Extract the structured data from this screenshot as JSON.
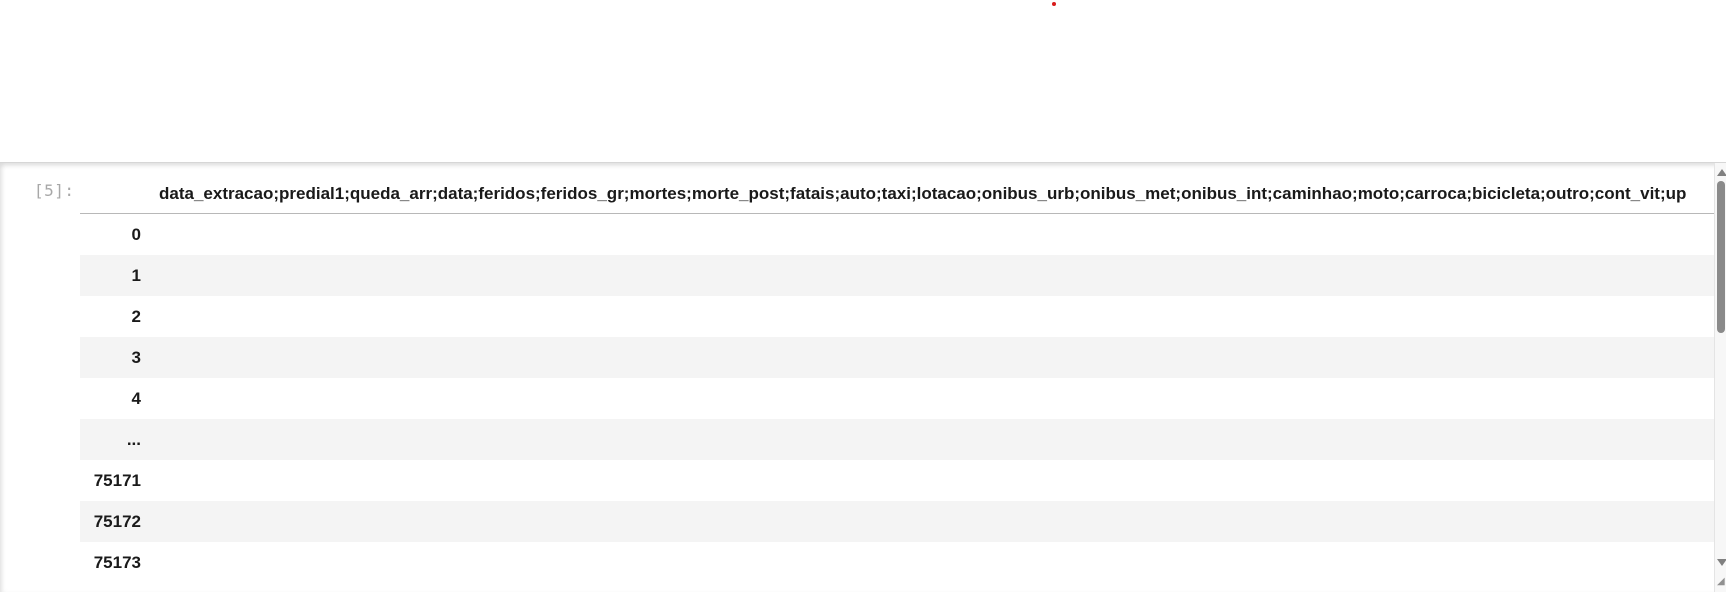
{
  "cell": {
    "prompt": "[5]:"
  },
  "table": {
    "header": "data_extracao;predial1;queda_arr;data;feridos;feridos_gr;mortes;morte_post;fatais;auto;taxi;lotacao;onibus_urb;onibus_met;onibus_int;caminhao;moto;carroca;bicicleta;outro;cont_vit;up",
    "rows": [
      {
        "index": "0"
      },
      {
        "index": "1"
      },
      {
        "index": "2"
      },
      {
        "index": "3"
      },
      {
        "index": "4"
      },
      {
        "index": "..."
      },
      {
        "index": "75171"
      },
      {
        "index": "75172"
      },
      {
        "index": "75173"
      }
    ]
  },
  "scrollbar": {
    "grip": "◢"
  },
  "colors": {
    "row_alt": "#f4f4f4",
    "marker": "#d81b1b",
    "prompt": "#a8a8a8"
  },
  "icons": {
    "scroll_up": "triangle-up-icon",
    "scroll_down": "triangle-down-icon"
  }
}
